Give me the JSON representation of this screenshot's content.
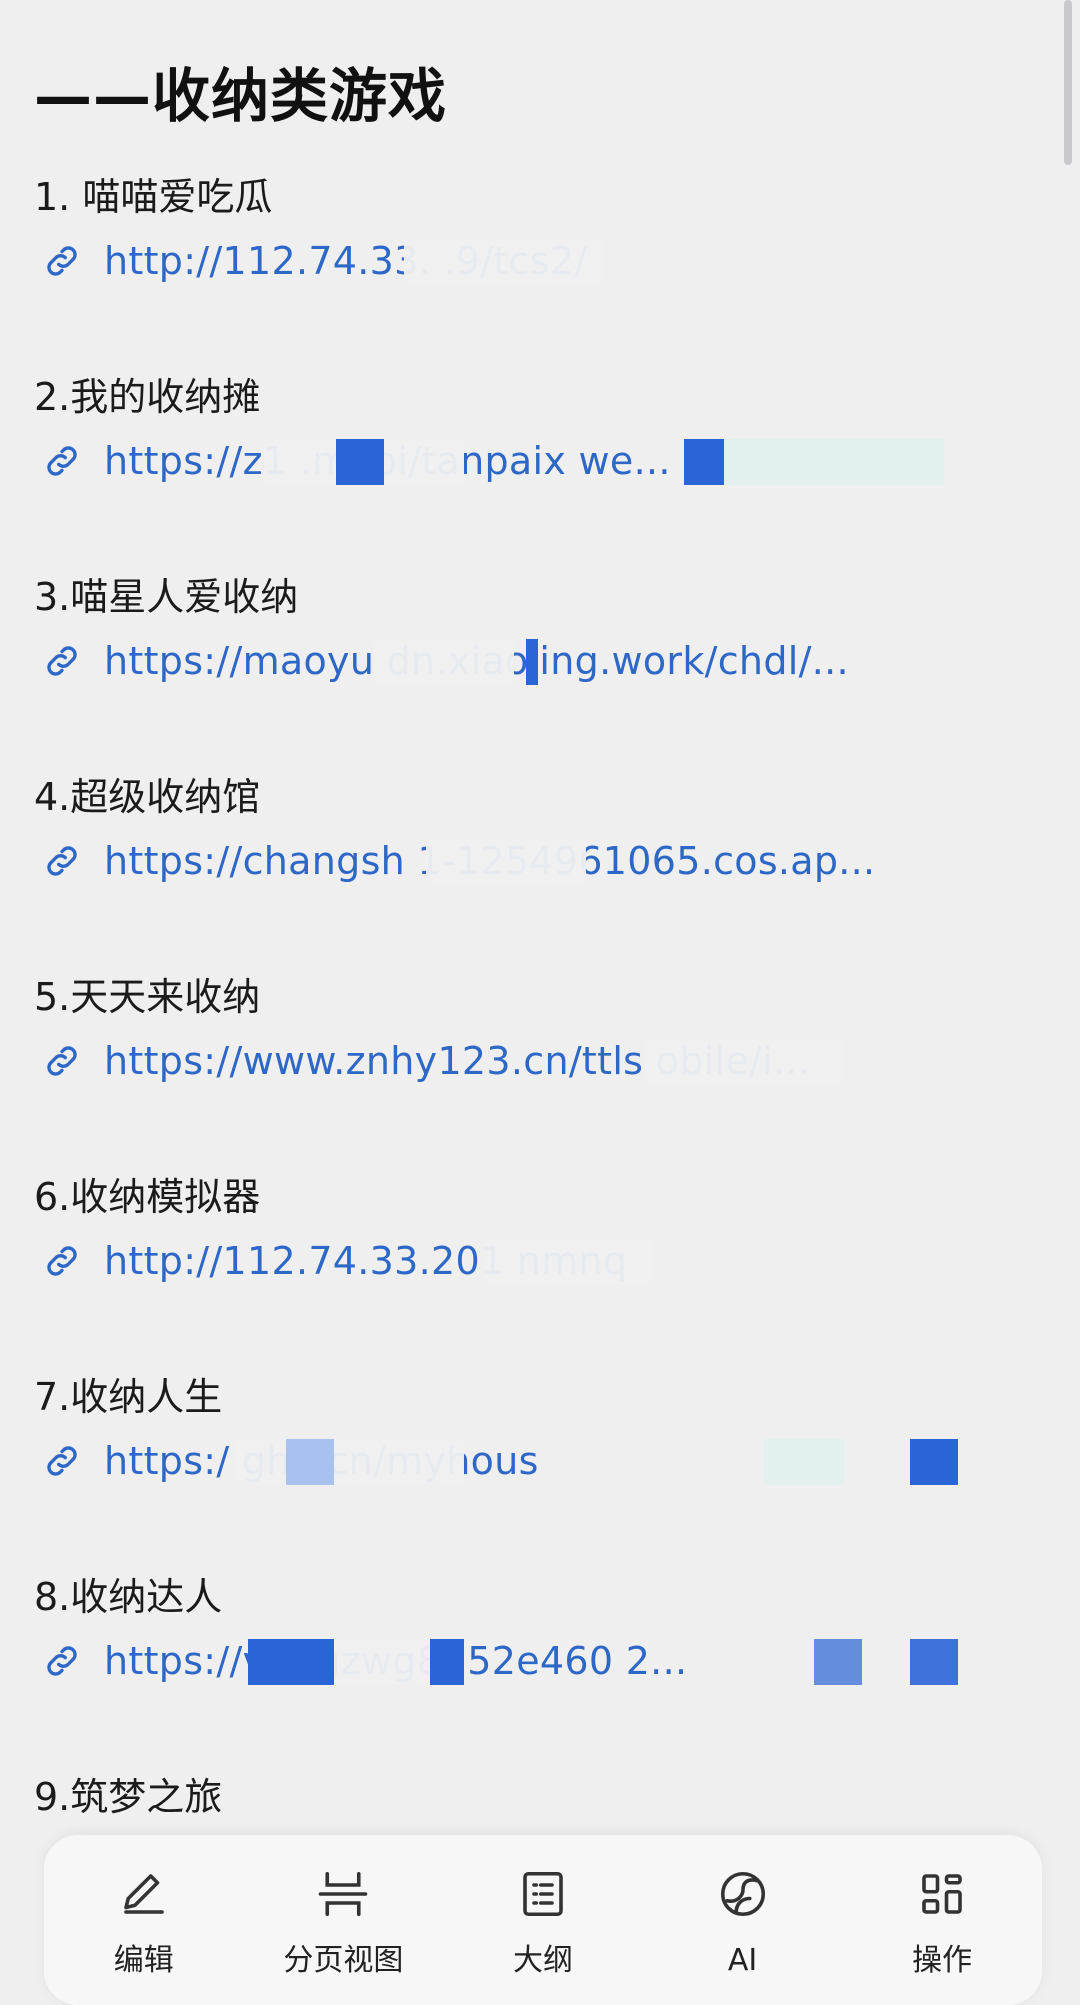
{
  "section": {
    "title": "——收纳类游戏"
  },
  "items": [
    {
      "title": "1.   喵喵爱吃瓜",
      "url": "http://112.74.33.         .9/tcs2/"
    },
    {
      "title": "2.我的收纳摊",
      "url": "https://z1                    .mobi/tanpaix                       we..."
    },
    {
      "title": "3.喵星人爱收纳",
      "url": "https://maoyu                   dn.xiaojing.work/chdl/..."
    },
    {
      "title": "4.超级收纳馆",
      "url": "https://changsh                  1-1254961065.cos.ap..."
    },
    {
      "title": "5.天天来收纳",
      "url": "https://www.znhy123.cn/ttls                      obile/i..."
    },
    {
      "title": "6.收纳模拟器",
      "url": "http://112.74.33.201                   nmnq"
    },
    {
      "title": "7.收纳人生",
      "url": "https:/                    ghd.cn/myhous"
    },
    {
      "title": "8.收纳达人",
      "url": "https://v                   -6gzwg8ti52e460                     2..."
    },
    {
      "title": "9.筑梦之旅",
      "url": ""
    }
  ],
  "toolbar": {
    "buttons": [
      {
        "label": "编辑",
        "icon": "pencil-icon"
      },
      {
        "label": "分页视图",
        "icon": "page-view-icon"
      },
      {
        "label": "大纲",
        "icon": "outline-icon"
      },
      {
        "label": "AI",
        "icon": "ai-icon"
      },
      {
        "label": "操作",
        "icon": "grid-icon"
      }
    ]
  },
  "colors": {
    "link": "#2e68c7",
    "background": "#efeff0",
    "redact_blue": "#2b64d6"
  }
}
